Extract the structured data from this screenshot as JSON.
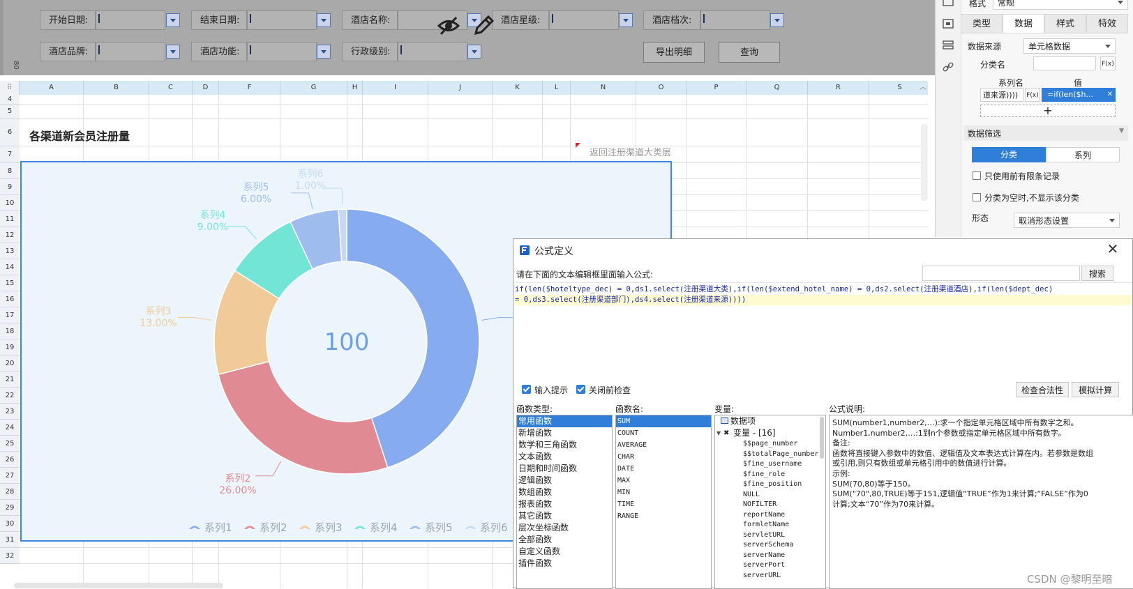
{
  "filters": {
    "start_date": "开始日期:",
    "end_date": "结束日期:",
    "hotel_name": "酒店名称:",
    "hotel_star": "酒店星级:",
    "hotel_grade": "酒店档次:",
    "hotel_brand": "酒店品牌:",
    "hotel_function": "酒店功能:",
    "admin_level": "行政级别:",
    "export_button": "导出明细",
    "query_button": "查询",
    "side_ruler": "80"
  },
  "right_panel": {
    "format_label": "格式",
    "format_value": "常规",
    "tabs": [
      "类型",
      "数据",
      "样式",
      "特效"
    ],
    "data_source_label": "数据来源",
    "data_source_value": "单元格数据",
    "category_label": "分类名",
    "fx": "F(x)",
    "series_name_header": "系列名",
    "value_header": "值",
    "series_name_cell": "道来源))))",
    "value_cell": "=if(len($h...",
    "add": "+",
    "filter_title": "数据筛选",
    "subtab_category": "分类",
    "subtab_series": "系列",
    "only_top_records": "只使用前有限条记录",
    "hide_empty": "分类为空时,不显示该分类",
    "form_label": "形态",
    "form_value": "取消形态设置"
  },
  "sheet": {
    "columns": [
      "A",
      "B",
      "C",
      "D",
      "F",
      "G",
      "H",
      "I",
      "J",
      "K",
      "L",
      "N",
      "O",
      "P",
      "Q",
      "R",
      "S"
    ],
    "rows": [
      "4",
      "5",
      "6",
      "7",
      "8",
      "9",
      "10",
      "11",
      "12",
      "13",
      "14",
      "15",
      "16",
      "17",
      "18",
      "19",
      "20",
      "21",
      "22",
      "23",
      "24",
      "25",
      "26",
      "27",
      "28",
      "29",
      "30",
      "31",
      "32"
    ],
    "report_title": "各渠道新会员注册量",
    "back_link": "返回注册渠道大类层"
  },
  "chart_data": {
    "type": "pie",
    "center_label": "100",
    "categories": [
      "系列1",
      "系列2",
      "系列3",
      "系列4",
      "系列5",
      "系列6"
    ],
    "values": [
      45.0,
      26.0,
      13.0,
      9.0,
      6.0,
      1.0
    ],
    "value_labels": [
      "",
      "26.00%",
      "13.00%",
      "9.00%",
      "6.00%",
      "1.00%"
    ],
    "colors": [
      "#86abef",
      "#e08a93",
      "#f0cb98",
      "#72e5d7",
      "#9fbcef",
      "#c6d8f4"
    ],
    "legend": [
      "系列1",
      "系列2",
      "系列3",
      "系列4",
      "系列5",
      "系列6"
    ],
    "legend_position": "bottom"
  },
  "dialog": {
    "title": "公式定义",
    "prompt": "请在下面的文本编辑框里面输入公式:",
    "search_button": "搜索",
    "formula_line1": "if(len($hoteltype_dec) = 0,ds1.select(注册渠道大类),if(len($extend_hotel_name) = 0,ds2.select(注册渠道酒店),if(len($dept_dec)",
    "formula_line2": "= 0,ds3.select(注册渠道部门),ds4.select(注册渠道来源))))",
    "input_hint": "输入提示",
    "check_before_close": "关闭前检查",
    "check_validity": "检查合法性",
    "simulate": "模拟计算",
    "func_type_label": "函数类型:",
    "func_name_label": "函数名:",
    "variable_label": "变量:",
    "description_label": "公式说明:",
    "func_types": [
      "常用函数",
      "新增函数",
      "数学和三角函数",
      "文本函数",
      "日期和时间函数",
      "逻辑函数",
      "数组函数",
      "报表函数",
      "其它函数",
      "层次坐标函数",
      "全部函数",
      "自定义函数",
      "插件函数"
    ],
    "func_names": [
      "SUM",
      "COUNT",
      "AVERAGE",
      "CHAR",
      "DATE",
      "MAX",
      "MIN",
      "TIME",
      "RANGE"
    ],
    "var_root": "数据项",
    "var_group": "变量 - [16]",
    "variables": [
      "$$page_number",
      "$$totalPage_number",
      "$fine_username",
      "$fine_role",
      "$fine_position",
      "NULL",
      "NOFILTER",
      "reportName",
      "formletName",
      "servletURL",
      "serverSchema",
      "serverName",
      "serverPort",
      "serverURL"
    ],
    "description": [
      "SUM(number1,number2,…):求一个指定单元格区域中所有数字之和。",
      "Number1,number2,…:1到n个参数或指定单元格区域中所有数字。",
      "备注:",
      "函数将直接键入参数中的数值、逻辑值及文本表达式计算在内。若参数是数组",
      "或引用,则只有数组或单元格引用中的数值进行计算。",
      "示例:",
      "SUM(70,80)等于150。",
      "SUM(\"70\",80,TRUE)等于151,逻辑值“TRUE”作为1来计算;“FALSE”作为0",
      "计算;文本“70”作为70来计算。"
    ]
  },
  "watermark": "CSDN @黎明至暗"
}
